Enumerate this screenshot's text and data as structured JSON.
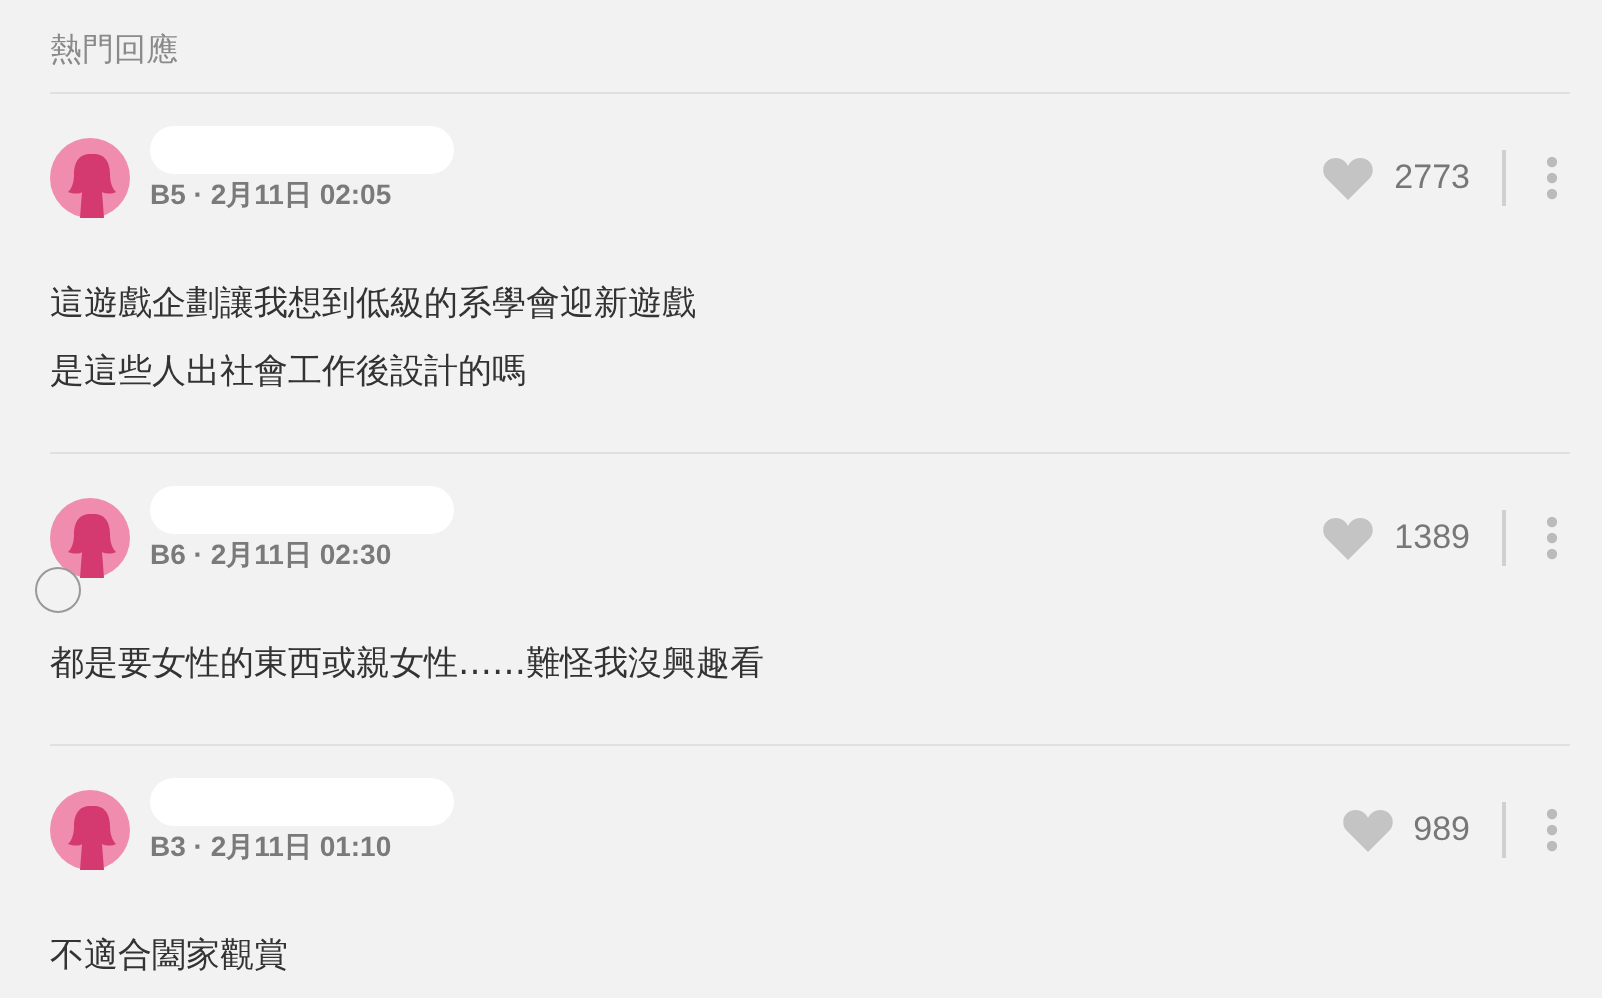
{
  "section_title": "熱門回應",
  "comments": [
    {
      "meta": "B5 · 2月11日 02:05",
      "likes": "2773",
      "lines": [
        "這遊戲企劃讓我想到低級的系學會迎新遊戲",
        "是這些人出社會工作後設計的嗎"
      ]
    },
    {
      "meta": "B6 · 2月11日 02:30",
      "likes": "1389",
      "lines": [
        "都是要女性的東西或親女性……難怪我沒興趣看"
      ]
    },
    {
      "meta": "B3 · 2月11日 01:10",
      "likes": "989",
      "lines": [
        "不適合闔家觀賞"
      ]
    }
  ]
}
